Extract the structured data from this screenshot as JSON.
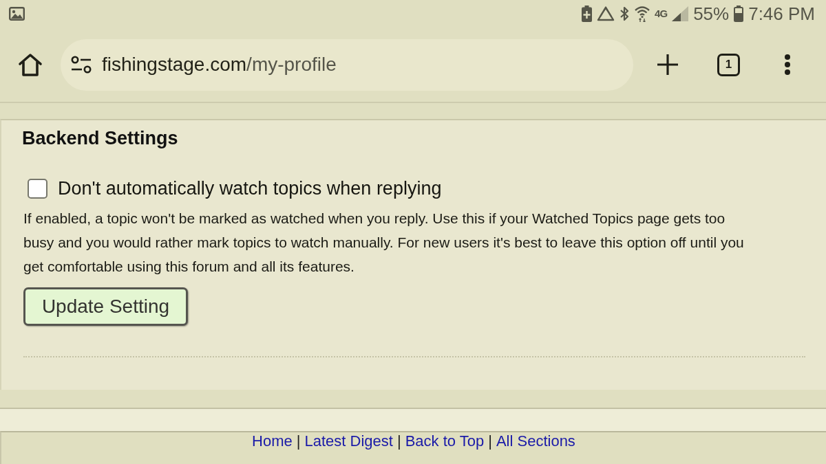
{
  "status_bar": {
    "network_type": "4G",
    "battery_percent": "55%",
    "time": "7:46 PM"
  },
  "browser": {
    "url_host": "fishingstage.com",
    "url_path": "/my-profile",
    "tab_count": "1"
  },
  "section": {
    "title": "Backend Settings",
    "option": {
      "label": "Don't automatically watch topics when replying",
      "checked": false
    },
    "description": "If enabled, a topic won't be marked as watched when you reply. Use this if your Watched Topics page gets too busy and you would rather mark topics to watch manually. For new users it's best to leave this option off until you get comfortable using this forum and all its features.",
    "button": "Update Setting"
  },
  "footer": {
    "items": [
      {
        "kind": "link",
        "text": "Home"
      },
      {
        "kind": "separator",
        "text": "|"
      },
      {
        "kind": "link",
        "text": "Latest Digest"
      },
      {
        "kind": "separator",
        "text": "|"
      },
      {
        "kind": "link",
        "text": "Back to Top"
      },
      {
        "kind": "separator",
        "text": "|"
      },
      {
        "kind": "link",
        "text": "All Sections"
      }
    ]
  }
}
